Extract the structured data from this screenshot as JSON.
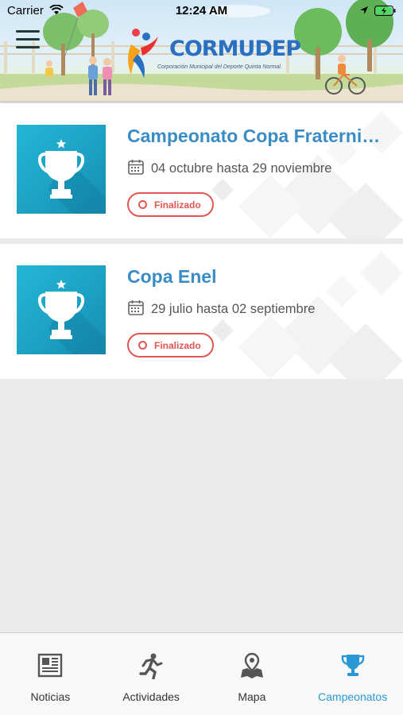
{
  "status_bar": {
    "carrier": "Carrier",
    "time": "12:24 AM",
    "icons": [
      "wifi-icon",
      "location-arrow-icon",
      "battery-charging-icon"
    ]
  },
  "header": {
    "menu_icon": "hamburger-menu-icon",
    "logo_title": "CORMUDEP",
    "logo_subtitle": "Corporación Municipal del Deporte Quinta Normal."
  },
  "campeonatos": [
    {
      "title": "Campeonato Copa Fraternidad",
      "dates": "04 octubre hasta 29 noviembre",
      "status": "Finalizado",
      "icon": "trophy-icon"
    },
    {
      "title": "Copa Enel",
      "dates": "29 julio hasta 02 septiembre",
      "status": "Finalizado",
      "icon": "trophy-icon"
    }
  ],
  "tabbar": {
    "active": "Campeonatos",
    "tabs": [
      {
        "label": "Noticias",
        "icon": "newspaper-icon"
      },
      {
        "label": "Actividades",
        "icon": "runner-icon"
      },
      {
        "label": "Mapa",
        "icon": "map-pin-icon"
      },
      {
        "label": "Campeonatos",
        "icon": "trophy-icon"
      }
    ]
  },
  "colors": {
    "accent": "#2a98d5",
    "title": "#3a8cc4",
    "status_finalizado": "#e05652",
    "thumb": "#1ea9cc"
  }
}
